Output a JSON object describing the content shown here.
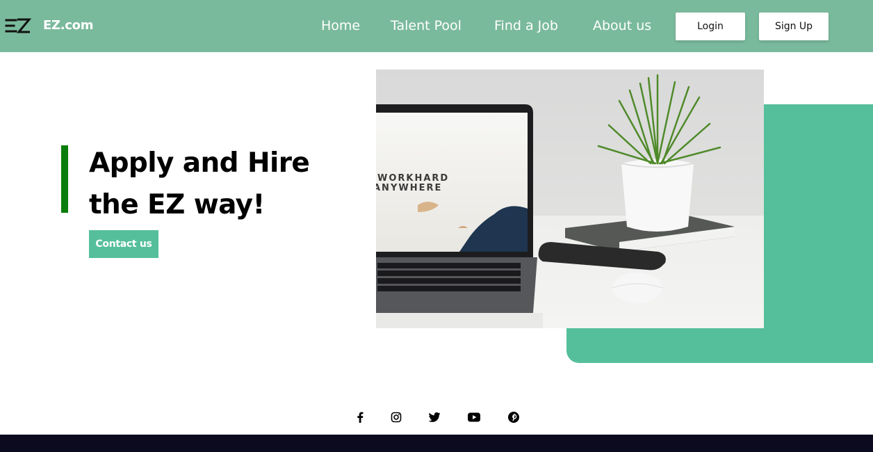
{
  "header": {
    "brand": "EZ.com",
    "logo": "ez-logo-icon",
    "nav": [
      {
        "label": "Home"
      },
      {
        "label": "Talent Pool"
      },
      {
        "label": "Find a Job"
      },
      {
        "label": "About us"
      }
    ],
    "login_label": "Login",
    "signup_label": "Sign Up"
  },
  "hero": {
    "title_line1": "Apply and Hire",
    "title_line2": "the EZ way!",
    "cta_label": "Contact us",
    "image": {
      "icon": "workspace-photo",
      "screen_line1": "WORKHARD",
      "screen_line2": "ANYWHERE"
    }
  },
  "social": [
    {
      "icon": "facebook-icon"
    },
    {
      "icon": "instagram-icon"
    },
    {
      "icon": "twitter-icon"
    },
    {
      "icon": "youtube-icon"
    },
    {
      "icon": "pinterest-icon"
    }
  ],
  "colors": {
    "nav_bg": "#7aba9c",
    "accent_green": "#55bf9b",
    "accent_bar": "#0a7d0a",
    "footer_bg": "#0b0a1f"
  }
}
